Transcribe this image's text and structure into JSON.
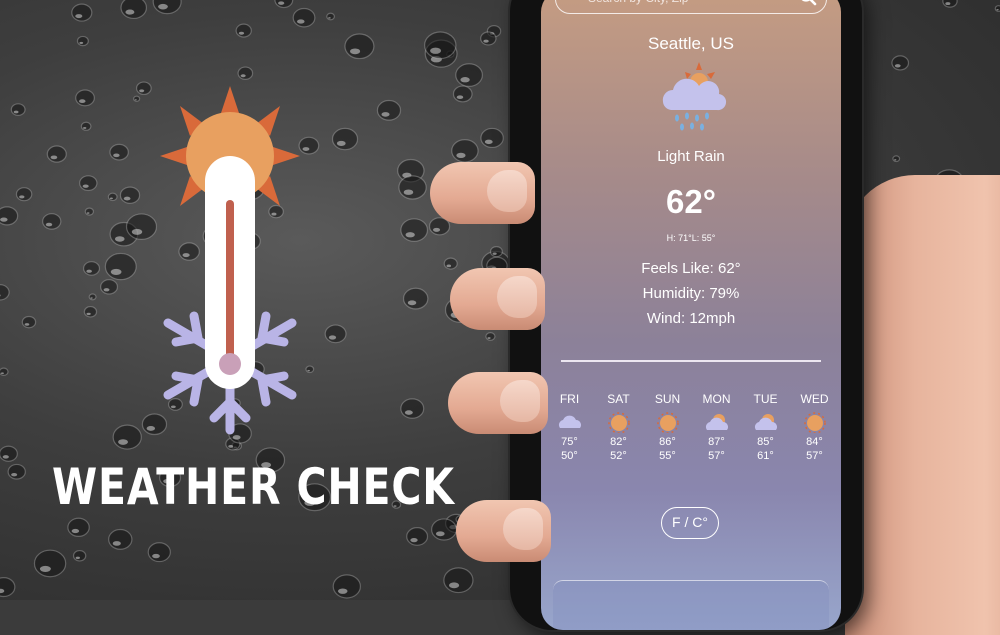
{
  "brand": {
    "title": "WEATHER CHECK"
  },
  "app": {
    "search": {
      "placeholder": "Search by City, Zip"
    },
    "location": "Seattle, US",
    "current": {
      "icon": "sun-cloud-rain-icon",
      "condition": "Light Rain",
      "temperature": "62°",
      "high_low": "H: 71°L: 55°",
      "feels_like": "Feels Like: 62°",
      "humidity": "Humidity: 79%",
      "wind": "Wind: 12mph"
    },
    "forecast": [
      {
        "day": "FRI",
        "icon": "cloud-icon",
        "high": "75°",
        "low": "50°"
      },
      {
        "day": "SAT",
        "icon": "sun-icon",
        "high": "82°",
        "low": "52°"
      },
      {
        "day": "SUN",
        "icon": "sun-icon",
        "high": "86°",
        "low": "55°"
      },
      {
        "day": "MON",
        "icon": "partly-cloudy-icon",
        "high": "87°",
        "low": "57°"
      },
      {
        "day": "TUE",
        "icon": "partly-cloudy-icon",
        "high": "85°",
        "low": "61°"
      },
      {
        "day": "WED",
        "icon": "sun-icon",
        "high": "84°",
        "low": "57°"
      }
    ],
    "unit_toggle": "F / C°"
  },
  "colors": {
    "sun": "#e8a060",
    "sun_rays": "#d96a3a",
    "snowflake": "#b9b4e6",
    "thermometer_fill": "#c0604e",
    "cloud": "#b8b8e4",
    "rain": "#7ab0e0"
  }
}
